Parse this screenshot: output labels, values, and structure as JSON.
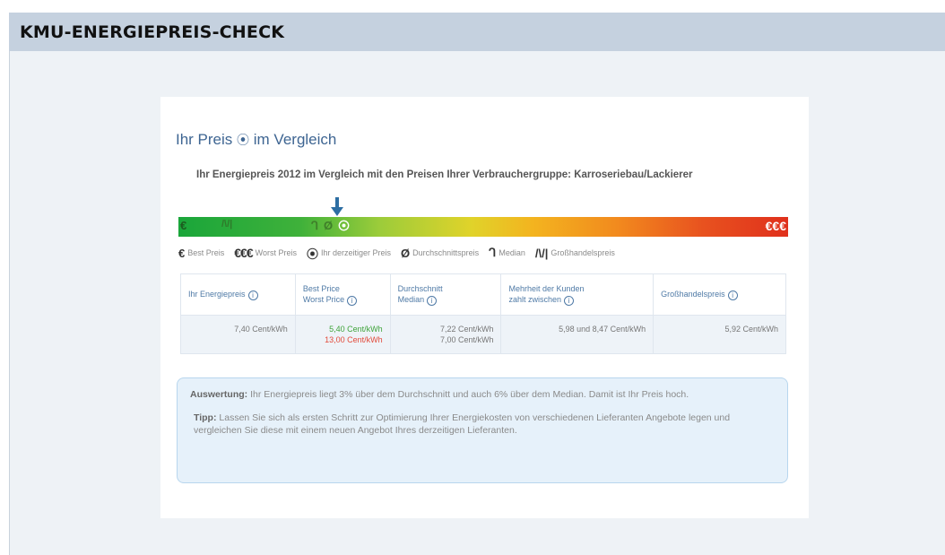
{
  "header": {
    "title": "KMU-ENERGIEPREIS-CHECK"
  },
  "card": {
    "title_prefix": "Ihr Preis",
    "title_suffix": "im Vergleich",
    "subtitle": "Ihr Energiepreis 2012 im Vergleich mit den Preisen Ihrer Verbrauchergruppe: Karroseriebau/Lackierer"
  },
  "scale": {
    "best_symbol": "€",
    "wholesale_symbol": "/\\/|",
    "median_symbol": "ᒉ",
    "average_symbol": "Ø",
    "current_symbol": "⦿",
    "worst_symbol": "€€€",
    "gradient_colors": [
      "#1aa63a",
      "#9ccc3a",
      "#e0d32a",
      "#f3b41f",
      "#e8521f",
      "#e0301c"
    ],
    "arrow_color": "#2d6ea3"
  },
  "legend": [
    {
      "symbol": "€",
      "label": "Best Preis"
    },
    {
      "symbol": "€€€",
      "label": "Worst Preis"
    },
    {
      "symbol": "⦿",
      "label": "Ihr derzeitiger Preis"
    },
    {
      "symbol": "Ø",
      "label": "Durchschnittspreis"
    },
    {
      "symbol": "ᒉ",
      "label": "Median"
    },
    {
      "symbol": "/\\/|",
      "label": "Großhandelspreis"
    }
  ],
  "table": {
    "headers": [
      {
        "line1": "Ihr Energiepreis",
        "line2": ""
      },
      {
        "line1": "Best Price",
        "line2": "Worst Price"
      },
      {
        "line1": "Durchschnitt",
        "line2": "Median"
      },
      {
        "line1": "Mehrheit der Kunden",
        "line2": "zahlt zwischen"
      },
      {
        "line1": "Großhandelspreis",
        "line2": ""
      }
    ],
    "row": {
      "energy_price": "7,40 Cent/kWh",
      "best_price": "5,40 Cent/kWh",
      "worst_price": "13,00 Cent/kWh",
      "average": "7,22 Cent/kWh",
      "median": "7,00 Cent/kWh",
      "majority_range": "5,98 und 8,47 Cent/kWh",
      "wholesale": "5,92 Cent/kWh"
    },
    "info_glyph": "i"
  },
  "evaluation": {
    "label": "Auswertung:",
    "text": "Ihr Energiepreis liegt 3% über dem Durchschnitt und auch 6% über dem Median. Damit ist Ihr Preis hoch.",
    "tip_label": "Tipp:",
    "tip_text": "Lassen Sie sich als ersten Schritt zur Optimierung Ihrer Energiekosten von verschiedenen Lieferanten Angebote legen und vergleichen Sie diese mit einem neuen Angebot Ihres derzeitigen Lieferanten."
  }
}
